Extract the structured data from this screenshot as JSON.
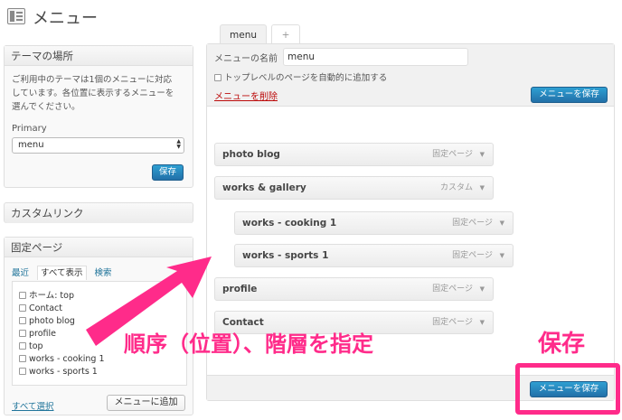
{
  "header": {
    "title": "メニュー",
    "icon": "menus-icon"
  },
  "theme_locations": {
    "title": "テーマの場所",
    "description_lines": [
      "ご利用中のテーマは1個のメニューに対応",
      "しています。各位置に表示するメニューを",
      "選んでください。"
    ],
    "location_label": "Primary",
    "selected_menu": "menu",
    "save_label": "保存"
  },
  "custom_links": {
    "title": "カスタムリンク"
  },
  "pages_box": {
    "title": "固定ページ",
    "tabs": [
      "最近",
      "すべて表示",
      "検索"
    ],
    "items": [
      "ホーム: top",
      "Contact",
      "photo blog",
      "profile",
      "top",
      "works - cooking 1",
      "works - sports 1"
    ],
    "select_all_label": "すべて選択",
    "add_to_menu_label": "メニューに追加"
  },
  "editor": {
    "tabs": [
      "menu",
      "+"
    ],
    "menu_name_label": "メニューの名前",
    "menu_name_value": "menu",
    "auto_add_label": "トップレベルのページを自動的に追加する",
    "delete_label": "メニューを削除",
    "save_label": "メニューを保存",
    "items": [
      {
        "title": "photo blog",
        "type": "固定ページ",
        "depth": 0
      },
      {
        "title": "works & gallery",
        "type": "カスタム",
        "depth": 0
      },
      {
        "title": "works - cooking 1",
        "type": "固定ページ",
        "depth": 1
      },
      {
        "title": "works - sports 1",
        "type": "固定ページ",
        "depth": 1
      },
      {
        "title": "profile",
        "type": "固定ページ",
        "depth": 0
      },
      {
        "title": "Contact",
        "type": "固定ページ",
        "depth": 0
      }
    ],
    "bottom_save_label": "メニューを保存"
  },
  "annotations": {
    "order_text": "順序（位置）、階層を指定",
    "save_text": "保存",
    "accent_color": "#ff2b8a"
  }
}
